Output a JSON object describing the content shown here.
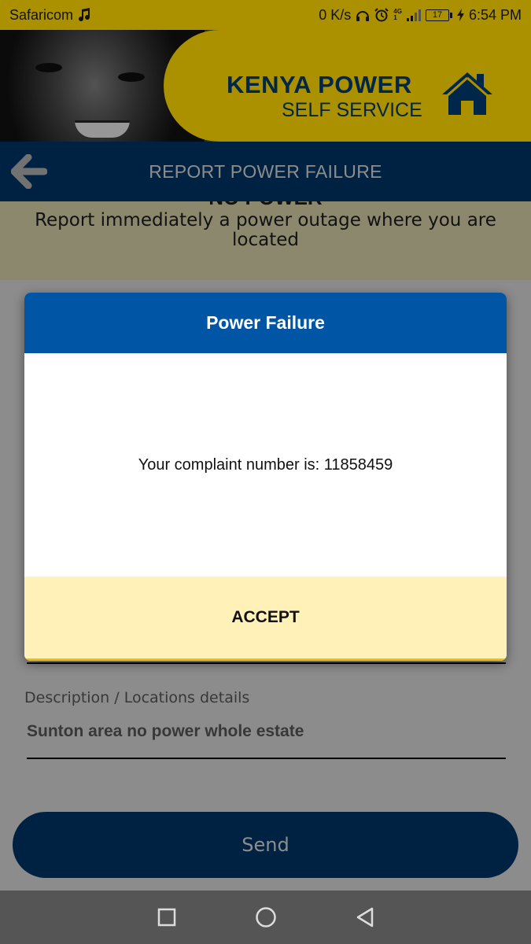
{
  "status_bar": {
    "carrier": "Safaricom",
    "net_speed": "0 K/s",
    "network_tag_top": "4G",
    "network_tag_bottom": "1",
    "battery": "17",
    "time": "6:54 PM"
  },
  "header": {
    "brand_title": "KENYA POWER",
    "brand_subtitle": "SELF SERVICE"
  },
  "navbar": {
    "title": "REPORT POWER FAILURE"
  },
  "info_panel": {
    "heading": "NO POWER",
    "text": "Report immediately a power outage where you are located"
  },
  "form": {
    "description_label": "Description / Locations details",
    "description_value": "Sunton area no power whole estate",
    "send_label": "Send"
  },
  "dialog": {
    "title": "Power Failure",
    "message": "Your complaint number is: 11858459",
    "accept_label": "ACCEPT"
  },
  "colors": {
    "brand_yellow": "#f5d000",
    "brand_blue": "#003e78",
    "dialog_header_blue": "#0055a4",
    "dialog_footer_yellow": "#fff1b8"
  }
}
